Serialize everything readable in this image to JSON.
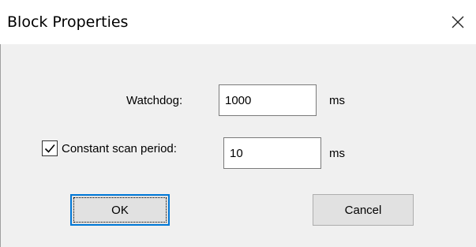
{
  "window": {
    "title": "Block Properties",
    "close_icon": "close-icon"
  },
  "form": {
    "watchdog": {
      "label": "Watchdog:",
      "value": "1000",
      "unit": "ms"
    },
    "constant_scan": {
      "checked": true,
      "label": "Constant scan period:",
      "value": "10",
      "unit": "ms"
    }
  },
  "buttons": {
    "ok_label": "OK",
    "cancel_label": "Cancel"
  },
  "colors": {
    "accent": "#0078d7",
    "client_bg": "#f0f0f0",
    "button_bg": "#e1e1e1"
  }
}
